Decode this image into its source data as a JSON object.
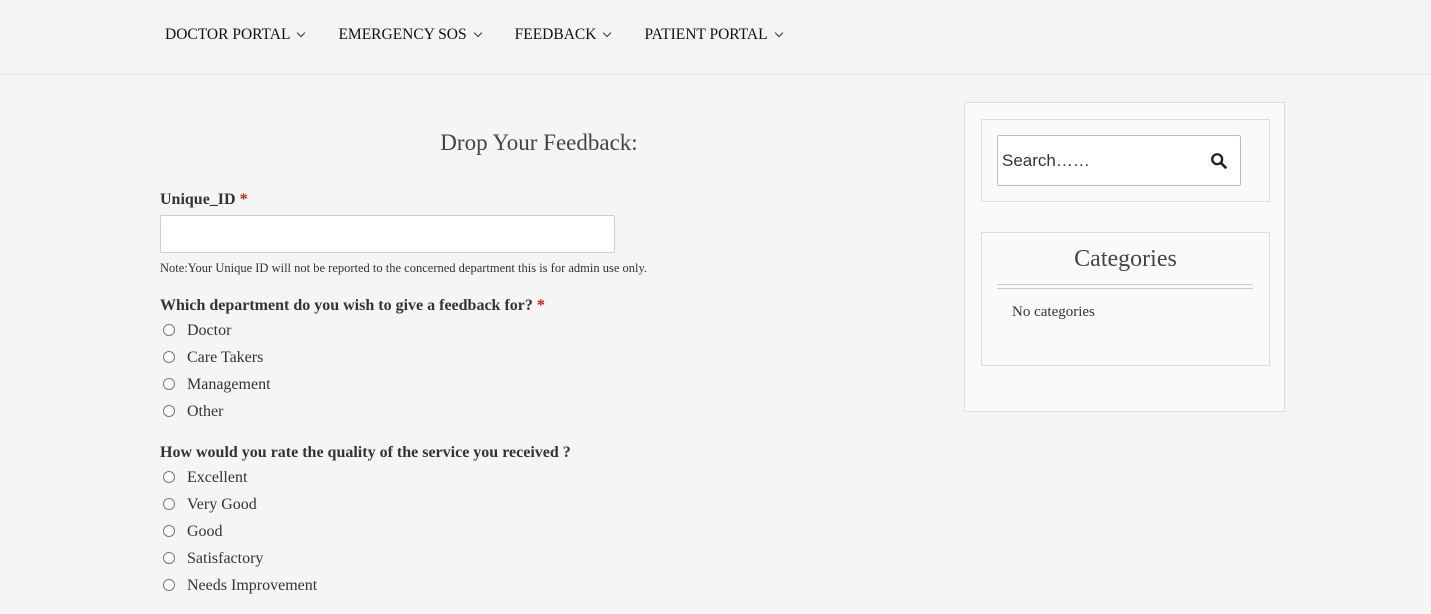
{
  "nav": {
    "items": [
      {
        "label": "DOCTOR PORTAL"
      },
      {
        "label": "EMERGENCY SOS"
      },
      {
        "label": "FEEDBACK"
      },
      {
        "label": "PATIENT PORTAL"
      }
    ]
  },
  "form": {
    "title": "Drop Your Feedback:",
    "unique_id": {
      "label": "Unique_ID",
      "required_mark": "*",
      "value": "",
      "note": "Note:Your Unique ID will not be reported to the concerned department this is for admin use only."
    },
    "department": {
      "question": "Which department do you wish to give a feedback for?",
      "required_mark": "*",
      "options": [
        "Doctor",
        "Care Takers",
        "Management",
        "Other"
      ]
    },
    "quality": {
      "question": "How would you rate the quality of the service you received ?",
      "options": [
        "Excellent",
        "Very Good",
        "Good",
        "Satisfactory",
        "Needs Improvement"
      ]
    }
  },
  "sidebar": {
    "search": {
      "placeholder": "Search……",
      "icon": "search-icon"
    },
    "categories": {
      "title": "Categories",
      "empty_text": "No categories"
    }
  }
}
